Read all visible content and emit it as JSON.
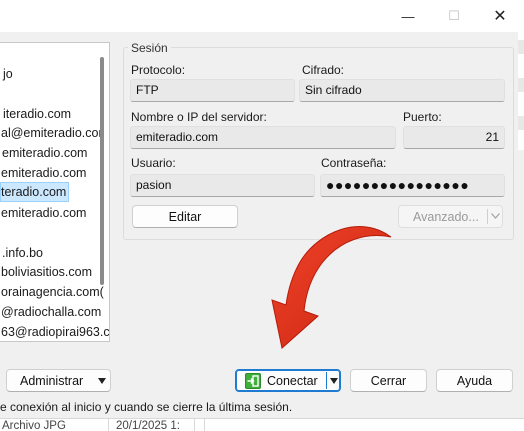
{
  "titlebar": {
    "minimize_glyph": "—",
    "maximize_glyph": "☐",
    "close_glyph": "✕"
  },
  "sites": [
    "jo",
    "iteradio.com",
    "al@emiteradio.cor",
    "emiteradio.com",
    "emiteradio.com",
    "teradio.com",
    "emiteradio.com",
    ".info.bo",
    "boliviasitios.com",
    "orainagencia.com(",
    "@radiochalla.com",
    "63@radiopirai963.c"
  ],
  "session": {
    "group_title": "Sesión",
    "protocol_label": "Protocolo:",
    "protocol_value": "FTP",
    "encryption_label": "Cifrado:",
    "encryption_value": "Sin cifrado",
    "host_label": "Nombre o IP del servidor:",
    "host_value": "emiteradio.com",
    "port_label": "Puerto:",
    "port_value": "21",
    "user_label": "Usuario:",
    "user_value": "pasion",
    "password_label": "Contraseña:",
    "password_value": "●●●●●●●●●●●●●●●●",
    "edit_button": "Editar",
    "advanced_button": "Avanzado..."
  },
  "footer": {
    "manage_button": "Administrar",
    "connect_button": "Conectar",
    "close_button": "Cerrar",
    "help_button": "Ayuda",
    "status_text": "e conexión al inicio y cuando se cierre la última sesión."
  },
  "background_row": {
    "name": "Archivo JPG",
    "date": "20/1/2025 1:"
  },
  "colors": {
    "accent": "#1f7ad1",
    "arrow": "#e8331c",
    "connect_icon": "#3fae3a"
  }
}
